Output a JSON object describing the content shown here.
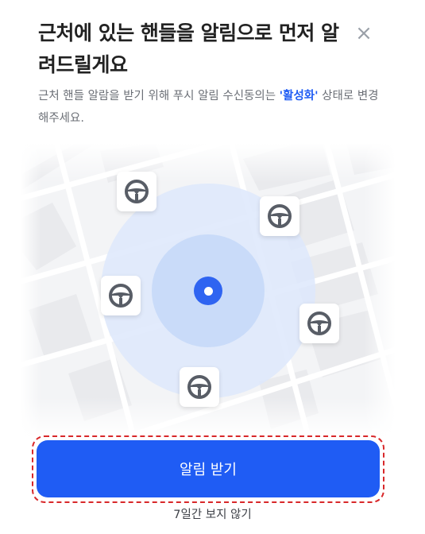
{
  "dialog": {
    "title": "근처에 있는 핸들을 알림으로 먼저 알려드릴게요",
    "close_icon": "×",
    "description_before": "근처 핸들 알람을 받기 위해 푸시 알림 수신동의는 ",
    "description_highlight": "'활성화'",
    "description_after": " 상태로 변경해주세요.",
    "accent_color": "#1f5cf4"
  },
  "map": {
    "icon": "steering-wheel-icon",
    "location_icon": "current-location-icon",
    "ring_color": "#dbe6fb",
    "car_count": 5
  },
  "actions": {
    "primary_label": "알림 받기",
    "secondary_label": "7일간 보지 않기"
  }
}
